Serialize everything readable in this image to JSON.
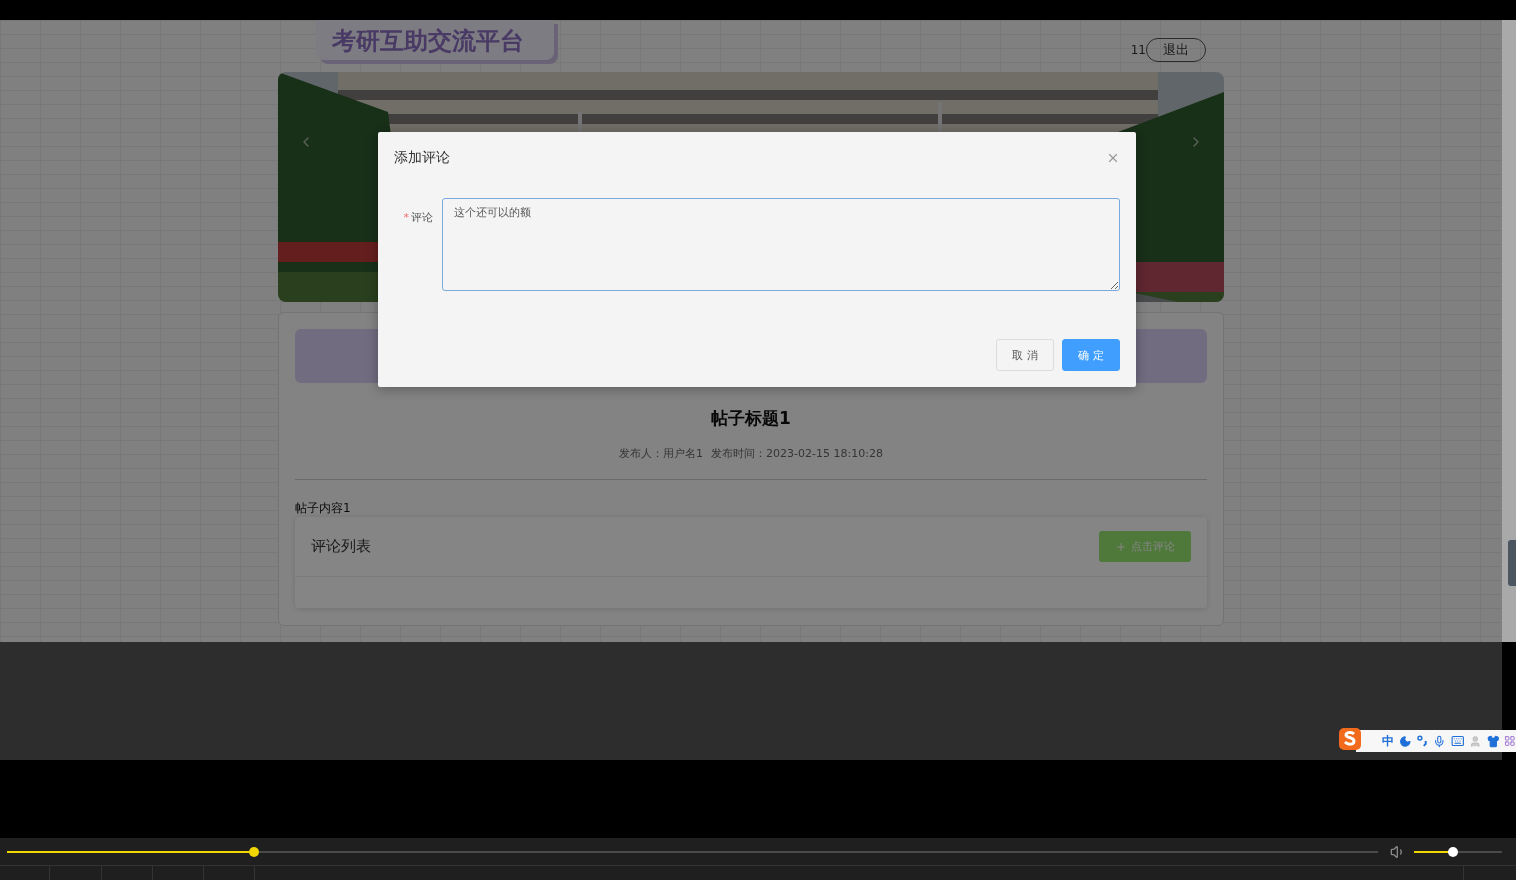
{
  "header": {
    "logo": "考研互助交流平台",
    "user": "11",
    "logout": "退出"
  },
  "post": {
    "title": "帖子标题1",
    "author": "发布人：用户名1",
    "time": "发布时间：2023-02-15 18:10:28",
    "content": "帖子内容1",
    "comments_title": "评论列表",
    "comment_button": "点击评论"
  },
  "dialog": {
    "title": "添加评论",
    "field_label": "评论",
    "required_mark": "*",
    "value": "这个还可以的额",
    "buttons": [
      {
        "label": "取 消",
        "kind": "default"
      },
      {
        "label": "确 定",
        "kind": "primary"
      }
    ]
  },
  "ime_toolbar": {
    "mode": "中"
  },
  "player": {
    "progress": {
      "level": 0.18
    },
    "volume": {
      "level": 0.44
    }
  }
}
